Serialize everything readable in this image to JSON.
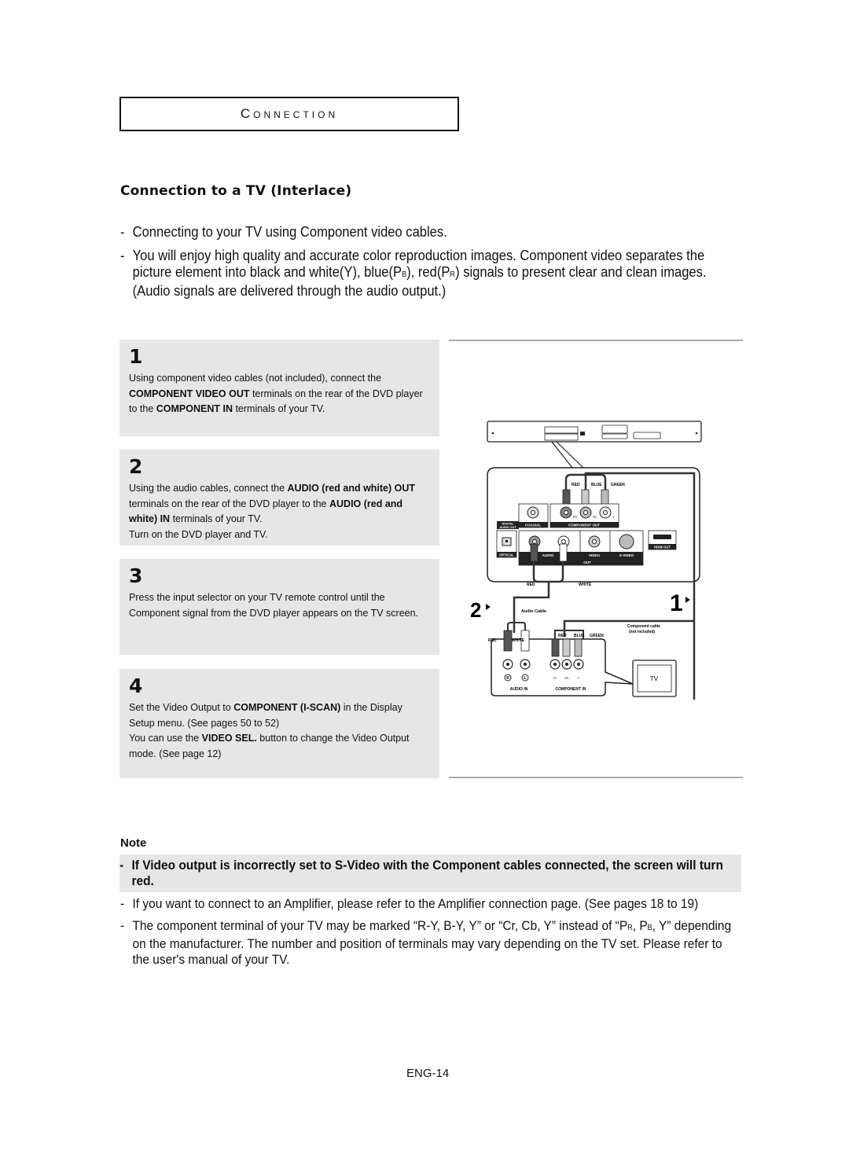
{
  "section": {
    "title": "Connection"
  },
  "subheading": "Connection to a TV (Interlace)",
  "intro": [
    "Connecting to your TV using Component video cables.",
    "You will enjoy high quality and accurate color reproduction images. Component video separates the picture element into black and white(Y), blue(PB), red(PR) signals to present clear and clean images. (Audio signals are delivered through the audio output.)"
  ],
  "steps": [
    {
      "number": "1",
      "parts": [
        {
          "t": "Using component video cables (not included), connect the "
        },
        {
          "b": "COMPONENT VIDEO OUT"
        },
        {
          "t": " terminals on the rear of the DVD player to the "
        },
        {
          "b": "COMPONENT IN"
        },
        {
          "t": " terminals of your TV."
        }
      ]
    },
    {
      "number": "2",
      "parts": [
        {
          "t": "Using the audio cables, connect the "
        },
        {
          "b": "AUDIO (red and white) OUT"
        },
        {
          "t": " terminals on the rear of the DVD player to the "
        },
        {
          "b": "AUDIO (red and white) IN"
        },
        {
          "t": " terminals of your TV."
        },
        {
          "br": true
        },
        {
          "t": "Turn on the DVD player and TV."
        }
      ]
    },
    {
      "number": "3",
      "parts": [
        {
          "t": "Press the input selector on your TV remote control until the Component signal from the DVD player appears on the TV screen."
        }
      ]
    },
    {
      "number": "4",
      "parts": [
        {
          "t": "Set the Video Output to "
        },
        {
          "b": "COMPONENT (I-SCAN)"
        },
        {
          "t": " in the Display Setup menu. (See pages 50 to 52)"
        },
        {
          "br": true
        },
        {
          "t": "You can use the "
        },
        {
          "b": "VIDEO SEL."
        },
        {
          "t": " button to change the Video Output mode. (See page 12)"
        }
      ]
    }
  ],
  "diagram": {
    "dvd_panel_labels": {
      "digital_audio_out": "DIGITAL AUDIO OUT",
      "coaxial": "COAXIAL",
      "component_out": "COMPONENT OUT",
      "optical": "OPTICAL",
      "audio": "AUDIO",
      "video": "VIDEO",
      "s_video": "S-VIDEO",
      "out": "OUT",
      "hdmi_out": "HDMI OUT",
      "pr": "PR",
      "pb": "PB",
      "y": "Y"
    },
    "cable_colors_top": [
      "RED",
      "BLUE",
      "GREEN"
    ],
    "audio_colors_top": [
      "RED",
      "WHITE"
    ],
    "step2_marker": "2",
    "step1_marker": "1",
    "audio_cable_label": "Audio Cable",
    "component_cable_label": [
      "Component cable",
      "(not included)"
    ],
    "tv_audio_colors": [
      "RED",
      "WHITE"
    ],
    "tv_component_colors": [
      "RED",
      "BLUE",
      "GREEN"
    ],
    "tv_jack_labels": [
      "R",
      "L",
      "Pr",
      "Pb",
      "Y"
    ],
    "audio_in": "AUDIO IN",
    "component_in": "COMPONENT IN",
    "tv_label": "TV",
    "colors": {
      "red_plug": "#555555",
      "blue_plug": "#bdbdbd",
      "green_plug": "#a8a8a8",
      "white_plug": "#ffffff"
    }
  },
  "note": {
    "label": "Note",
    "bold_item": "If Video output is incorrectly set to S-Video with the Component cables connected, the screen will turn red.",
    "items": [
      "If you want to connect to an Amplifier, please refer to the Amplifier connection page. (See pages 18 to 19)",
      "The component terminal of your TV may be marked “R-Y, B-Y, Y” or “Cr, Cb, Y” instead of “PR, PB, Y” depending on the manufacturer. The number and position of terminals may vary depending on the TV set. Please refer to the user's manual of your TV."
    ]
  },
  "page_number": "ENG-14"
}
